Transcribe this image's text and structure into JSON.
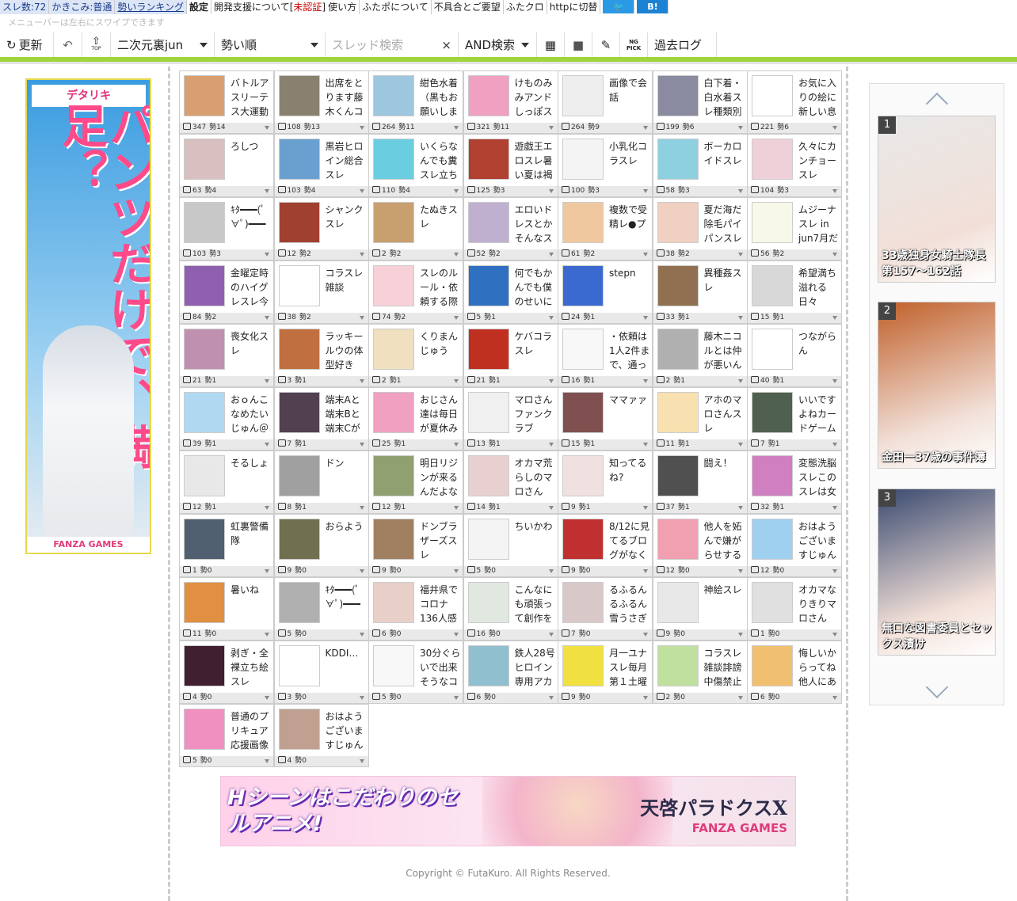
{
  "topbar": {
    "items": [
      {
        "label": "スレ数:72",
        "style": "blue"
      },
      {
        "label": "かきこみ:普通",
        "style": "blue"
      },
      {
        "label": "勢いランキング",
        "style": "ul blue"
      },
      {
        "label": "設定",
        "style": "bold"
      },
      {
        "label": "開発支援について[",
        "style": ""
      },
      {
        "label": "未認証",
        "style": "red"
      },
      {
        "label": "]",
        "style": ""
      },
      {
        "label": "使い方",
        "style": ""
      },
      {
        "label": "ふたポについて",
        "style": ""
      },
      {
        "label": "不具合とご要望",
        "style": ""
      },
      {
        "label": "ふたクロ",
        "style": ""
      },
      {
        "label": "httpに切替",
        "style": ""
      }
    ],
    "twitter_label": "🐦",
    "hatena_label": "B!",
    "note": "メニューバーは左右にスワイプできます"
  },
  "toolbar": {
    "refresh": "更新",
    "back_icon": "↶",
    "top_icon": "⇧",
    "top_sub": "TOP",
    "board": "二次元裏jun",
    "order": "勢い順",
    "search_placeholder": "スレッド検索",
    "clear": "×",
    "search_mode": "AND検索",
    "grid_icon": "▦",
    "square_icon": "■",
    "pen_icon": "✎",
    "ng_label": "NG",
    "pick_label": "PICK",
    "log": "過去ログ"
  },
  "left_ad": {
    "logo": "デタリキ",
    "headline": "パンツだけで、満足？",
    "brand": "FANZA GAMES"
  },
  "threads": [
    {
      "title": "バトルアスリーテス大運動",
      "res": "347",
      "ikioi": "14",
      "color": "#d8a070"
    },
    {
      "title": "出席をとります藤木くんコ",
      "res": "108",
      "ikioi": "13",
      "color": "#8a8070"
    },
    {
      "title": "紺色水着（黒もお願いしま",
      "res": "264",
      "ikioi": "11",
      "color": "#9cc7df"
    },
    {
      "title": "けものみみアンドしっぽス",
      "res": "321",
      "ikioi": "11",
      "color": "#f0a0c0"
    },
    {
      "title": "画像で会話",
      "res": "264",
      "ikioi": "9",
      "color": "#eeeeee"
    },
    {
      "title": "白下着・白水着スレ種類別",
      "res": "199",
      "ikioi": "6",
      "color": "#8a8aa0"
    },
    {
      "title": "お気に入りの絵に新しい息",
      "res": "221",
      "ikioi": "6",
      "color": "#ffffff"
    },
    {
      "title": "ろしつ",
      "res": "63",
      "ikioi": "4",
      "color": "#d8c0c0"
    },
    {
      "title": "黒岩ヒロイン総合スレ",
      "res": "103",
      "ikioi": "4",
      "color": "#6aa0d0"
    },
    {
      "title": "いくらなんでも糞スレ立ち",
      "res": "110",
      "ikioi": "4",
      "color": "#6acde0"
    },
    {
      "title": "遊戯王エロスレ暑い夏は褐",
      "res": "125",
      "ikioi": "3",
      "color": "#b04030"
    },
    {
      "title": "小乳化コラスレ",
      "res": "100",
      "ikioi": "3",
      "color": "#f4f4f4"
    },
    {
      "title": "ボーカロイドスレ",
      "res": "58",
      "ikioi": "3",
      "color": "#8fd0e0"
    },
    {
      "title": "久々にカンチョースレ",
      "res": "104",
      "ikioi": "3",
      "color": "#f0d0d8"
    },
    {
      "title": "ｷﾀ━━━(ﾟ∀ﾟ)━━━",
      "res": "103",
      "ikioi": "3",
      "color": "#c8c8c8"
    },
    {
      "title": "シャンクスレ",
      "res": "12",
      "ikioi": "2",
      "color": "#a04030"
    },
    {
      "title": "たぬきスレ",
      "res": "2",
      "ikioi": "2",
      "color": "#c8a070"
    },
    {
      "title": "エロいドレスとかそんなス",
      "res": "52",
      "ikioi": "2",
      "color": "#c0b0d0"
    },
    {
      "title": "複数で受精レ●プ",
      "res": "61",
      "ikioi": "2",
      "color": "#f0c8a0"
    },
    {
      "title": "夏だ海だ除毛パイパンスレ",
      "res": "38",
      "ikioi": "2",
      "color": "#f0d0c0"
    },
    {
      "title": "ムジーナスレ in jun7月だ",
      "res": "56",
      "ikioi": "2",
      "color": "#f8f8e8"
    },
    {
      "title": "金曜定時のハイグレスレ今",
      "res": "84",
      "ikioi": "2",
      "color": "#9060b0"
    },
    {
      "title": "コラスレ雑談",
      "res": "38",
      "ikioi": "2",
      "color": "#ffffff"
    },
    {
      "title": "スレのルール・依頼する際",
      "res": "74",
      "ikioi": "2",
      "color": "#f8d0d8"
    },
    {
      "title": "何でもかんでも僕のせいに",
      "res": "5",
      "ikioi": "1",
      "color": "#3070c0"
    },
    {
      "title": "stepn",
      "res": "24",
      "ikioi": "1",
      "color": "#3a6ad0"
    },
    {
      "title": "異種姦スレ",
      "res": "33",
      "ikioi": "1",
      "color": "#907050"
    },
    {
      "title": "希望満ち溢れる日々",
      "res": "15",
      "ikioi": "1",
      "color": "#d8d8d8"
    },
    {
      "title": "喪女化スレ",
      "res": "21",
      "ikioi": "1",
      "color": "#c090b0"
    },
    {
      "title": "ラッキールウの体型好き",
      "res": "3",
      "ikioi": "1",
      "color": "#c07040"
    },
    {
      "title": "くりまんじゅう",
      "res": "2",
      "ikioi": "1",
      "color": "#f0e0c0"
    },
    {
      "title": "ケバコラスレ",
      "res": "21",
      "ikioi": "1",
      "color": "#c03020"
    },
    {
      "title": "・依頼は1人2件まで、通っ",
      "res": "16",
      "ikioi": "1",
      "color": "#f8f8f8"
    },
    {
      "title": "藤木ニコルとは仲が悪いん",
      "res": "2",
      "ikioi": "1",
      "color": "#b0b0b0"
    },
    {
      "title": "つながらん",
      "res": "40",
      "ikioi": "1",
      "color": "#ffffff"
    },
    {
      "title": "おｏんこなめたいじゅん＠",
      "res": "39",
      "ikioi": "1",
      "color": "#b0d8f0"
    },
    {
      "title": "端末Aと端末Bと端末Cが",
      "res": "7",
      "ikioi": "1",
      "color": "#504050"
    },
    {
      "title": "おじさん達は毎日が夏休み",
      "res": "25",
      "ikioi": "1",
      "color": "#f0a0c0"
    },
    {
      "title": "マロさんファンクラブ",
      "res": "13",
      "ikioi": "1",
      "color": "#f0f0f0"
    },
    {
      "title": "ママァァ",
      "res": "15",
      "ikioi": "1",
      "color": "#805050"
    },
    {
      "title": "アホのマロさんスレ",
      "res": "11",
      "ikioi": "1",
      "color": "#f8e0b0"
    },
    {
      "title": "いいですよねカードゲーム",
      "res": "7",
      "ikioi": "1",
      "color": "#506050"
    },
    {
      "title": "そるしょ",
      "res": "12",
      "ikioi": "1",
      "color": "#e8e8e8"
    },
    {
      "title": "ドン",
      "res": "8",
      "ikioi": "1",
      "color": "#a0a0a0"
    },
    {
      "title": "明日リジンが来るんだよな",
      "res": "12",
      "ikioi": "1",
      "color": "#90a070"
    },
    {
      "title": "オカマ荒らしのマロさん",
      "res": "14",
      "ikioi": "1",
      "color": "#e8d0d0"
    },
    {
      "title": "知ってるね?",
      "res": "9",
      "ikioi": "1",
      "color": "#f0e0e0"
    },
    {
      "title": "闘え！",
      "res": "37",
      "ikioi": "1",
      "color": "#505050"
    },
    {
      "title": "変態洗脳スレこのスレは女",
      "res": "32",
      "ikioi": "1",
      "color": "#d080c0"
    },
    {
      "title": "虹裏警備隊",
      "res": "1",
      "ikioi": "0",
      "color": "#506070"
    },
    {
      "title": "おらよう",
      "res": "9",
      "ikioi": "0",
      "color": "#707050"
    },
    {
      "title": "ドンブラザーズスレ",
      "res": "9",
      "ikioi": "0",
      "color": "#a08060"
    },
    {
      "title": "ちいかわ",
      "res": "5",
      "ikioi": "0",
      "color": "#f4f4f4"
    },
    {
      "title": "8/12に見てるブログがなく",
      "res": "9",
      "ikioi": "0",
      "color": "#c03030"
    },
    {
      "title": "他人を妬んで嫌がらせする",
      "res": "12",
      "ikioi": "0",
      "color": "#f0a0b0"
    },
    {
      "title": "おはようございますじゅん",
      "res": "12",
      "ikioi": "0",
      "color": "#a0d0f0"
    },
    {
      "title": "暑いね",
      "res": "11",
      "ikioi": "0",
      "color": "#e09040"
    },
    {
      "title": "ｷﾀ━━━(ﾟ∀ﾟ)━━━",
      "res": "5",
      "ikioi": "0",
      "color": "#b0b0b0"
    },
    {
      "title": "福井県でコロナ136人感",
      "res": "6",
      "ikioi": "0",
      "color": "#e8d0c8"
    },
    {
      "title": "こんなにも頑張って創作を",
      "res": "16",
      "ikioi": "0",
      "color": "#e0e8e0"
    },
    {
      "title": "るふるんるふるん雪うさぎ",
      "res": "7",
      "ikioi": "0",
      "color": "#d8c8c8"
    },
    {
      "title": "神絵スレ",
      "res": "9",
      "ikioi": "0",
      "color": "#e8e8e8"
    },
    {
      "title": "オカマなりきりマロさん",
      "res": "1",
      "ikioi": "0",
      "color": "#e0e0e0"
    },
    {
      "title": "剥ぎ・全裸立ち絵スレ",
      "res": "4",
      "ikioi": "0",
      "color": "#402030"
    },
    {
      "title": "KDDI…",
      "res": "3",
      "ikioi": "0",
      "color": "#ffffff"
    },
    {
      "title": "30分ぐらいで出来そうなコ",
      "res": "5",
      "ikioi": "0",
      "color": "#f8f8f8"
    },
    {
      "title": "鉄人28号ヒロイン専用アカ",
      "res": "6",
      "ikioi": "0",
      "color": "#90c0d0"
    },
    {
      "title": "月一ユナスレ毎月第１土曜",
      "res": "9",
      "ikioi": "0",
      "color": "#f0e040"
    },
    {
      "title": "コラスレ雑談誹謗中傷禁止",
      "res": "2",
      "ikioi": "0",
      "color": "#c0e0a0"
    },
    {
      "title": "悔しいからってね他人にあ",
      "res": "6",
      "ikioi": "0",
      "color": "#f0c070"
    },
    {
      "title": "普通のプリキュア応援画像",
      "res": "5",
      "ikioi": "0",
      "color": "#f090c0"
    },
    {
      "title": "おはようございますじゅん",
      "res": "4",
      "ikioi": "0",
      "color": "#c0a090"
    }
  ],
  "stat_prefix": "勢",
  "bottom_ad": {
    "left": "Hシーンはこだわりのセルアニメ!",
    "title": "天啓パラドクスX",
    "brand": "FANZA GAMES"
  },
  "copyright": "Copyright © FutaKuro. All Rights Reserved.",
  "ranking": [
    {
      "rank": "1",
      "text": "33歳独身女騎士隊長 第157〜162話",
      "bg": "#e8e8e8"
    },
    {
      "rank": "2",
      "text": "金田一37歳の事件簿",
      "bg": "#c0602a"
    },
    {
      "rank": "3",
      "text": "無口な図書委員とセックス漬け",
      "bg": "#3a4a70"
    }
  ]
}
